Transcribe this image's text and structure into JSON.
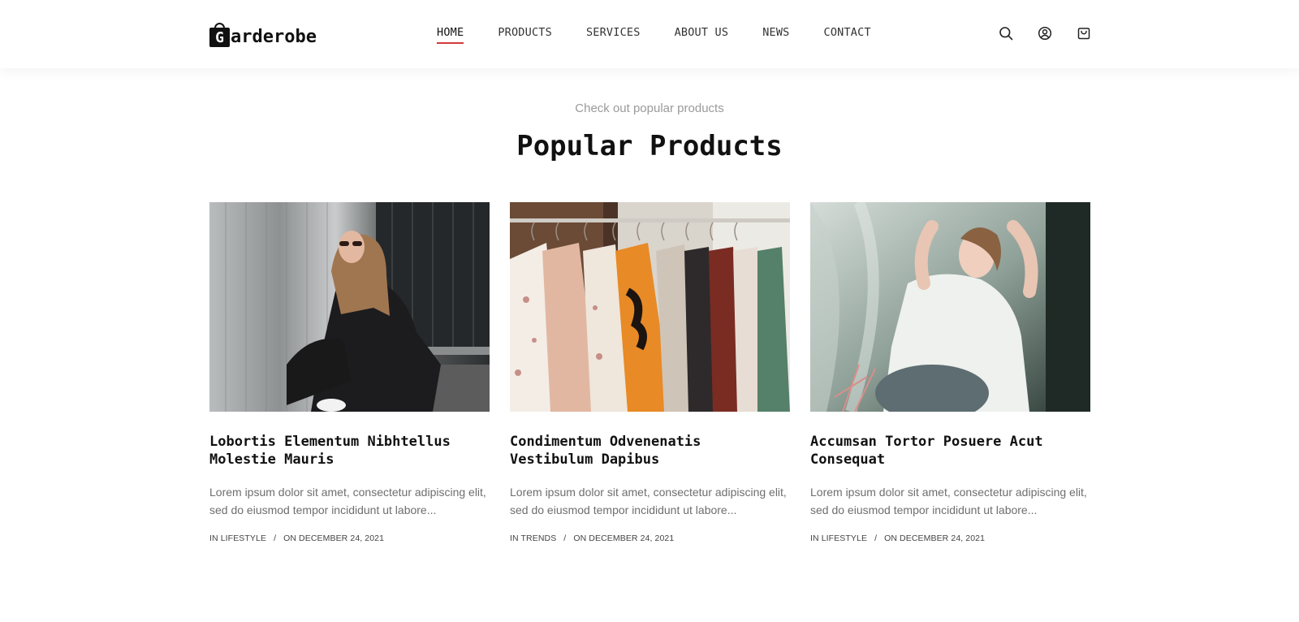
{
  "header": {
    "logo_initial": "G",
    "logo_text": "arderobe",
    "nav": [
      {
        "label": "HOME",
        "active": true
      },
      {
        "label": "PRODUCTS",
        "active": false
      },
      {
        "label": "SERVICES",
        "active": false
      },
      {
        "label": "ABOUT US",
        "active": false
      },
      {
        "label": "NEWS",
        "active": false
      },
      {
        "label": "CONTACT",
        "active": false
      }
    ],
    "icons": [
      "search-icon",
      "user-icon",
      "cart-icon"
    ],
    "active_underline_color": "#d33a3a"
  },
  "section": {
    "eyebrow": "Check out popular products",
    "title": "Popular Products"
  },
  "cards": [
    {
      "image": "woman-in-sunglasses-black-hoodie",
      "title": "Lobortis Elementum Nibhtellus Molestie Mauris",
      "excerpt": "Lorem ipsum dolor sit amet, consectetur adipiscing elit, sed do eiusmod tempor incididunt ut labore...",
      "category": "IN LIFESTYLE",
      "date": "ON DECEMBER 24, 2021"
    },
    {
      "image": "clothing-rack-with-shirts",
      "title": "Condimentum Odvenenatis Vestibulum Dapibus",
      "excerpt": "Lorem ipsum dolor sit amet, consectetur adipiscing elit, sed do eiusmod tempor incididunt ut labore...",
      "category": "IN TRENDS",
      "date": "ON DECEMBER 24, 2021"
    },
    {
      "image": "woman-in-white-blouse",
      "title": "Accumsan Tortor Posuere Acut Consequat",
      "excerpt": "Lorem ipsum dolor sit amet, consectetur adipiscing elit, sed do eiusmod tempor incididunt ut labore...",
      "category": "IN LIFESTYLE",
      "date": "ON DECEMBER 24, 2021"
    }
  ],
  "meta_separator": "/"
}
